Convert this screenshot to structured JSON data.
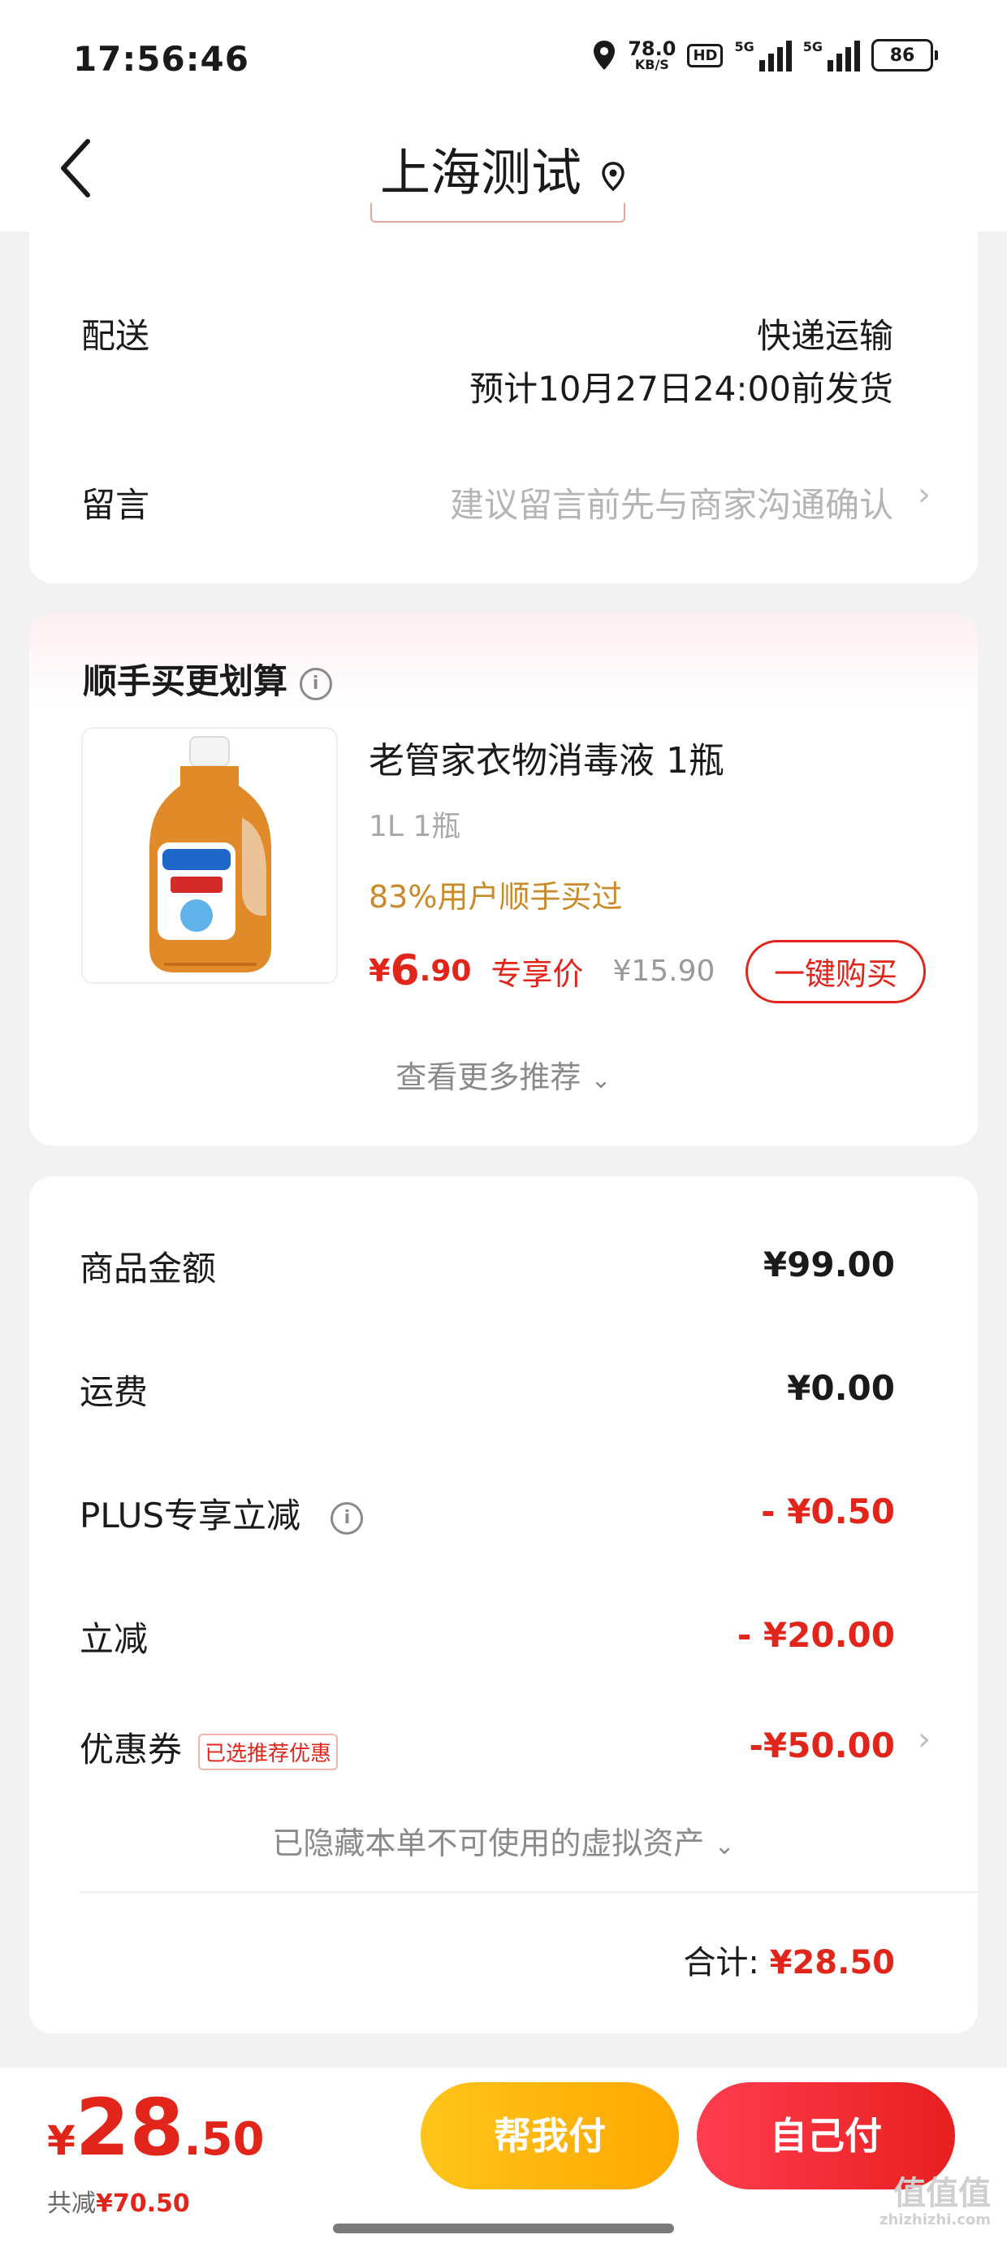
{
  "status_bar": {
    "time": "17:56:46",
    "net_speed": "78.0",
    "net_unit": "KB/S",
    "hd": "HD",
    "sig1": "5G",
    "sig2": "5G",
    "battery": "86"
  },
  "nav": {
    "title": "上海测试"
  },
  "delivery": {
    "label": "配送",
    "method": "快递运输",
    "eta": "预计10月27日24:00前发货"
  },
  "message": {
    "label": "留言",
    "placeholder": "建议留言前先与商家沟通确认"
  },
  "addon": {
    "title": "顺手买更划算",
    "product_name": "老管家衣物消毒液 1瓶",
    "spec": "1L 1瓶",
    "buyers": "83%用户顺手买过",
    "price_symbol": "¥",
    "price_int": "6",
    "price_dec": ".90",
    "price_tag": "专享价",
    "original_price": "¥15.90",
    "buy_label": "一键购买",
    "more": "查看更多推荐"
  },
  "summary": {
    "items": [
      {
        "label": "商品金额",
        "value": "¥99.00"
      },
      {
        "label": "运费",
        "value": "¥0.00"
      },
      {
        "label": "PLUS专享立减",
        "value": "- ¥0.50"
      },
      {
        "label": "立减",
        "value": "- ¥20.00"
      },
      {
        "label": "优惠券",
        "value": "-¥50.00",
        "badge": "已选推荐优惠"
      }
    ],
    "hidden_assets": "已隐藏本单不可使用的虚拟资产",
    "total_label": "合计:",
    "total_value": "¥28.50"
  },
  "bottom_bar": {
    "symbol": "¥",
    "int": "28",
    "dec": ".50",
    "saved_label": "共减",
    "saved_value": "¥70.50",
    "help_pay": "帮我付",
    "self_pay": "自己付"
  },
  "watermark": {
    "main": "值值值",
    "sub": "zhizhizhi.com"
  },
  "colors": {
    "accent": "#e1251b",
    "gold": "#c98a2a",
    "help_btn": "#ffb400",
    "self_btn": "#f0282e"
  },
  "icons": [
    "back-arrow-icon",
    "location-pin-icon",
    "info-icon",
    "chevron-right-icon",
    "chevron-down-icon"
  ]
}
